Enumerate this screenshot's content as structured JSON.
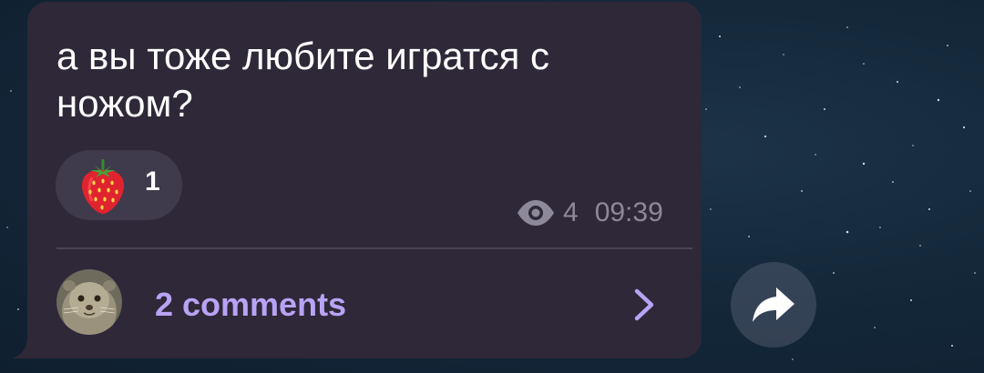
{
  "message": {
    "text": "а вы тоже любите игратся с ножом?",
    "reaction": {
      "emoji_icon": "strawberry-icon",
      "count": "1"
    },
    "meta": {
      "views_icon": "eye-icon",
      "views": "4",
      "time": "09:39"
    },
    "comments": {
      "label": "2 comments",
      "chevron_icon": "chevron-right-icon"
    },
    "share_icon": "share-arrow-icon"
  },
  "colors": {
    "bubble": "#2e2838",
    "accent": "#b9a3f5",
    "meta_text": "#8e899a"
  }
}
